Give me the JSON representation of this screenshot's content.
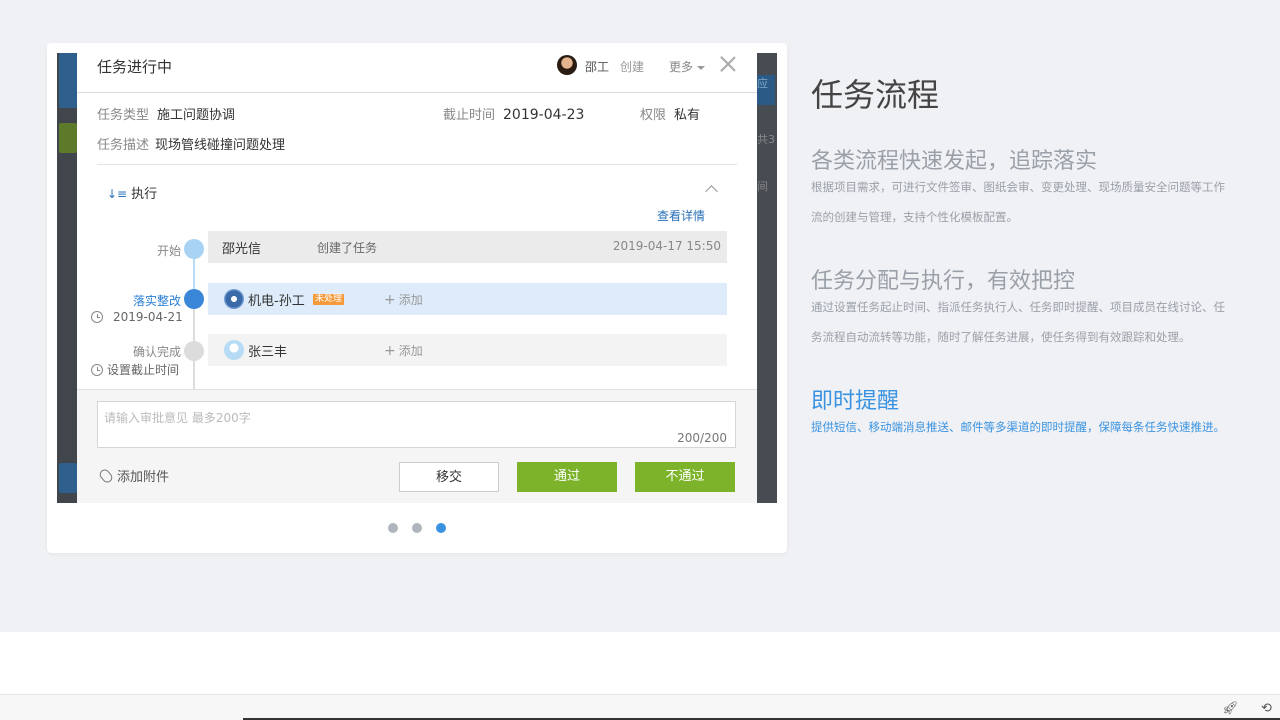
{
  "modal": {
    "title": "任务进行中",
    "creator_name": "邵工",
    "creator_action": "创建",
    "more_label": "更多",
    "fields": {
      "type_label": "任务类型",
      "type_value": "施工问题协调",
      "deadline_label": "截止时间",
      "deadline_value": "2019-04-23",
      "perm_label": "权限",
      "perm_value": "私有",
      "desc_label": "任务描述",
      "desc_value": "现场管线碰撞问题处理"
    },
    "section_title": "执行",
    "view_detail": "查看详情",
    "steps": [
      {
        "label": "开始",
        "who": "邵光信",
        "action": "创建了任务",
        "time": "2019-04-17 15:50"
      },
      {
        "label": "落实整改",
        "date": "2019-04-21",
        "who": "机电-孙工",
        "badge": "未处理",
        "add": "添加"
      },
      {
        "label": "确认完成",
        "date": "设置截止时间",
        "who": "张三丰",
        "add": "添加"
      }
    ],
    "comment_placeholder": "请输入审批意见 最多200字",
    "comment_count": "200/200",
    "attach_label": "添加附件",
    "buttons": {
      "transfer": "移交",
      "pass": "通过",
      "reject": "不通过"
    }
  },
  "carousel": {
    "count": 3,
    "active_index": 2
  },
  "side": {
    "heading": "任务流程",
    "features": [
      {
        "title": "各类流程快速发起，追踪落实",
        "desc_line1": "根据项目需求，可进行文件签审、图纸会审、变更处理、现场质量安全问题等工作",
        "desc_line2": "流的创建与管理，支持个性化模板配置。",
        "active": false
      },
      {
        "title": "任务分配与执行，有效把控",
        "desc_line1": "通过设置任务起止时间、指派任务执行人、任务即时提醒、项目成员在线讨论、任",
        "desc_line2": "务流程自动流转等功能，随时了解任务进展，使任务得到有效跟踪和处理。",
        "active": false
      },
      {
        "title": "即时提醒",
        "desc_line1": "提供短信、移动端消息推送、邮件等多渠道的即时提醒，保障每条任务快速推进。",
        "active": true
      }
    ]
  },
  "background_peek": {
    "right_chars": [
      "应",
      "共3",
      "间"
    ]
  },
  "colors": {
    "accent_blue": "#3a93e0",
    "pass_green": "#7cb32a",
    "badge_orange": "#f59a3b"
  }
}
